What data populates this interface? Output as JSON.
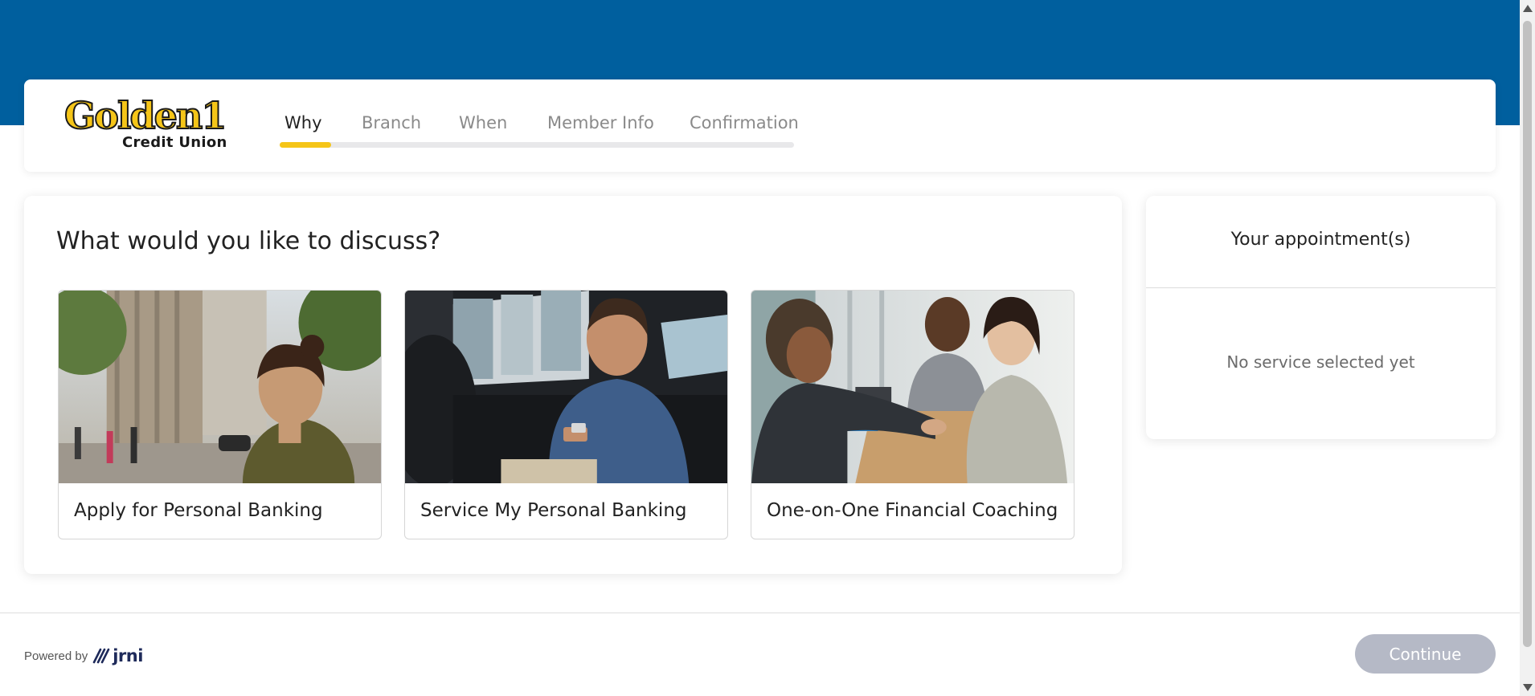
{
  "brand": {
    "logo_word": "Golden1",
    "logo_sub": "Credit Union",
    "primary_color": "#005f9e",
    "accent_color": "#f5c518"
  },
  "steps": [
    {
      "label": "Why",
      "active": true
    },
    {
      "label": "Branch",
      "active": false
    },
    {
      "label": "When",
      "active": false
    },
    {
      "label": "Member Info",
      "active": false
    },
    {
      "label": "Confirmation",
      "active": false
    }
  ],
  "progress_fraction": 0.1,
  "main": {
    "title": "What would you like to discuss?",
    "options": [
      {
        "label": "Apply for Personal Banking",
        "image": "woman-city-street-photo"
      },
      {
        "label": "Service My Personal Banking",
        "image": "man-in-car-phone-photo"
      },
      {
        "label": "One-on-One Financial Coaching",
        "image": "meeting-handshake-photo"
      }
    ]
  },
  "sidebar": {
    "title": "Your appointment(s)",
    "empty_text": "No service selected yet"
  },
  "footer": {
    "powered_by": "Powered by",
    "provider_name": "jrni",
    "continue_label": "Continue",
    "continue_color": "#b5b9c6"
  }
}
